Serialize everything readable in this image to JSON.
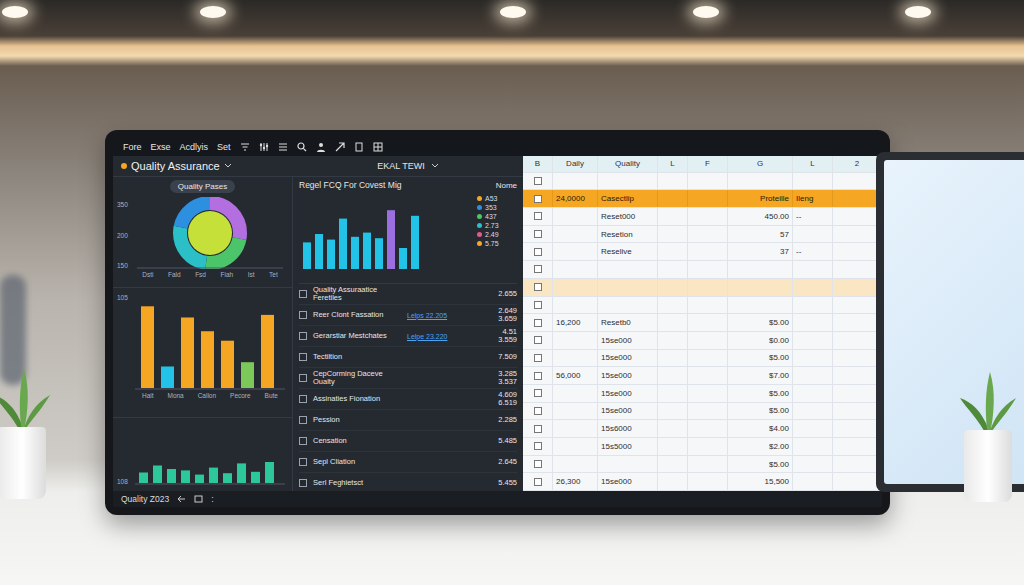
{
  "menu": [
    "Fore",
    "Exse",
    "Acdlyis",
    "Set"
  ],
  "header": {
    "title": "Quality Assurance",
    "center_title": "EKAL TEWI"
  },
  "donut_panel": {
    "pill": "Quality Pases",
    "y_ticks": [
      "350",
      "200",
      "150"
    ],
    "x_labels": [
      "Dsti",
      "Fald",
      "Fsd",
      "Fiah",
      "Ist",
      "Tet"
    ],
    "segments": [
      {
        "value": 28,
        "color": "#b36ee0"
      },
      {
        "value": 24,
        "color": "#4cc46a"
      },
      {
        "value": 26,
        "color": "#2bc0c8"
      },
      {
        "value": 22,
        "color": "#2d8fe0"
      }
    ]
  },
  "column_chart": {
    "title": "Regel FCQ For Covest Mig",
    "legend_title": "Nome",
    "bars": [
      {
        "value": 38,
        "color": "#22c3e6"
      },
      {
        "value": 50,
        "color": "#22c3e6"
      },
      {
        "value": 42,
        "color": "#22c3e6"
      },
      {
        "value": 72,
        "color": "#22c3e6"
      },
      {
        "value": 46,
        "color": "#22c3e6"
      },
      {
        "value": 52,
        "color": "#22c3e6"
      },
      {
        "value": 44,
        "color": "#22c3e6"
      },
      {
        "value": 84,
        "color": "#9b6fe0"
      },
      {
        "value": 30,
        "color": "#22c3e6"
      },
      {
        "value": 76,
        "color": "#22c3e6"
      }
    ],
    "legend": [
      {
        "label": "A53",
        "color": "#f5a623"
      },
      {
        "label": "353",
        "color": "#2d8fe0"
      },
      {
        "label": "437",
        "color": "#4cc46a"
      },
      {
        "label": "2.73",
        "color": "#2bc0c8"
      },
      {
        "label": "2.49",
        "color": "#e05b8a"
      },
      {
        "label": "5.75",
        "color": "#f5a623"
      }
    ]
  },
  "orange_chart": {
    "y_tick": "105",
    "x_labels": [
      "Hait",
      "Mona",
      "Callon",
      "Pecore",
      "Bute"
    ],
    "bars": [
      {
        "value": 95,
        "color": "#f5a623"
      },
      {
        "value": 25,
        "color": "#22c3e6"
      },
      {
        "value": 82,
        "color": "#f5a623"
      },
      {
        "value": 66,
        "color": "#f5a623"
      },
      {
        "value": 55,
        "color": "#f5a623"
      },
      {
        "value": 30,
        "color": "#7cc95a"
      },
      {
        "value": 85,
        "color": "#f5a623"
      }
    ]
  },
  "mini_chart": {
    "y_tick": "108",
    "values": [
      15,
      25,
      20,
      18,
      12,
      22,
      14,
      28,
      16,
      30
    ]
  },
  "qa_list": [
    {
      "name": "Quality Assuraatice Feretiles",
      "link": "",
      "values": [
        "2.655"
      ],
      "checked": false
    },
    {
      "name": "Reer Clont Fassation",
      "link": "Lelps 22.205",
      "values": [
        "2.649",
        "3.659"
      ],
      "checked": false
    },
    {
      "name": "Gerarstiar Mestchates",
      "link": "Lelpe 23.220",
      "values": [
        "4.51",
        "3.559"
      ],
      "checked": false
    },
    {
      "name": "Tectiltion",
      "link": "",
      "values": [
        "7.509"
      ],
      "checked": false
    },
    {
      "name": "CepCorming Daceve Oualty",
      "link": "",
      "values": [
        "3.285",
        "3.537"
      ],
      "checked": false
    },
    {
      "name": "Assinaties Fionation",
      "link": "",
      "values": [
        "4.609",
        "6.519"
      ],
      "checked": false
    },
    {
      "name": "Pession",
      "link": "",
      "values": [
        "2.285"
      ],
      "checked": false
    },
    {
      "name": "Censation",
      "link": "",
      "values": [
        "5.485"
      ],
      "checked": false
    },
    {
      "name": "Sepl Cliation",
      "link": "",
      "values": [
        "2.645"
      ],
      "checked": false
    },
    {
      "name": "Serl Feghietsct",
      "link": "",
      "values": [
        "5.455"
      ],
      "checked": false
    }
  ],
  "sheet": {
    "columns": [
      "B",
      "Daily",
      "Quality",
      "L",
      "F",
      "G",
      "L",
      "2"
    ],
    "rows": [
      {
        "kind": "plain",
        "checked": false,
        "cells": [
          "",
          "",
          "",
          "",
          "",
          "",
          ""
        ]
      },
      {
        "kind": "highlight",
        "checked": false,
        "cells": [
          "24,0000",
          "Casectlip",
          "",
          "",
          "Proteille",
          "Ileng",
          ""
        ]
      },
      {
        "kind": "plain",
        "checked": false,
        "cells": [
          "",
          "Reset000",
          "",
          "",
          "450.00",
          "--",
          ""
        ]
      },
      {
        "kind": "plain",
        "checked": false,
        "cells": [
          "",
          "Resetion",
          "",
          "",
          "57",
          "",
          ""
        ]
      },
      {
        "kind": "plain",
        "checked": false,
        "cells": [
          "",
          "Reselive",
          "",
          "",
          "37",
          "--",
          ""
        ]
      },
      {
        "kind": "plain",
        "checked": false,
        "cells": [
          "",
          "",
          "",
          "",
          "",
          "",
          ""
        ]
      },
      {
        "kind": "soft",
        "checked": false,
        "cells": [
          "",
          "",
          "",
          "",
          "",
          "",
          ""
        ]
      },
      {
        "kind": "plain",
        "checked": false,
        "cells": [
          "",
          "",
          "",
          "",
          "",
          "",
          ""
        ]
      },
      {
        "kind": "plain",
        "checked": false,
        "cells": [
          "16,200",
          "Resetb0",
          "",
          "",
          "$5.00",
          "",
          ""
        ]
      },
      {
        "kind": "plain",
        "checked": false,
        "cells": [
          "",
          "15se000",
          "",
          "",
          "$0.00",
          "",
          ""
        ]
      },
      {
        "kind": "plain",
        "checked": false,
        "cells": [
          "",
          "15se000",
          "",
          "",
          "$5.00",
          "",
          ""
        ]
      },
      {
        "kind": "plain",
        "checked": false,
        "cells": [
          "56,000",
          "15se000",
          "",
          "",
          "$7.00",
          "",
          ""
        ]
      },
      {
        "kind": "plain",
        "checked": false,
        "cells": [
          "",
          "15se000",
          "",
          "",
          "$5.00",
          "",
          ""
        ]
      },
      {
        "kind": "plain",
        "checked": false,
        "cells": [
          "",
          "15se000",
          "",
          "",
          "$5.00",
          "",
          ""
        ]
      },
      {
        "kind": "plain",
        "checked": false,
        "cells": [
          "",
          "15s6000",
          "",
          "",
          "$4.00",
          "",
          ""
        ]
      },
      {
        "kind": "plain",
        "checked": false,
        "cells": [
          "",
          "15s5000",
          "",
          "",
          "$2.00",
          "",
          ""
        ]
      },
      {
        "kind": "plain",
        "checked": false,
        "cells": [
          "",
          "",
          "",
          "",
          "$5.00",
          "",
          ""
        ]
      },
      {
        "kind": "plain",
        "checked": false,
        "cells": [
          "26,300",
          "15se000",
          "",
          "",
          "15,500",
          "",
          ""
        ]
      }
    ]
  },
  "status_bar": {
    "label": "Quality Z023",
    "more": ":"
  }
}
